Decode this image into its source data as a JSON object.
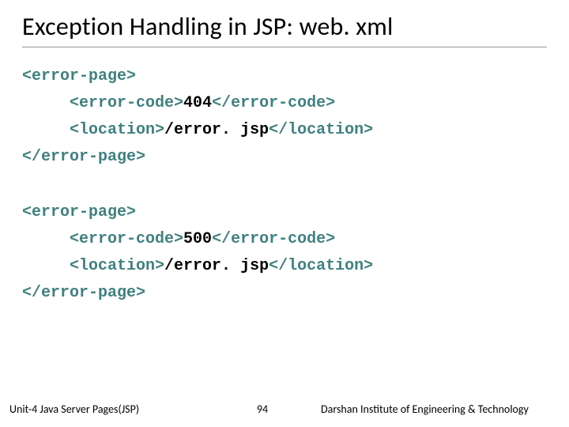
{
  "title": "Exception Handling in JSP: web. xml",
  "code_blocks": [
    {
      "open_outer": "<error-page>",
      "line1_open": "<error-code>",
      "line1_text": "404",
      "line1_close": "</error-code>",
      "line2_open": "<location>",
      "line2_text": "/error. jsp",
      "line2_close": "</location>",
      "close_outer": "</error-page>"
    },
    {
      "open_outer": "<error-page>",
      "line1_open": "<error-code>",
      "line1_text": "500",
      "line1_close": "</error-code>",
      "line2_open": "<location>",
      "line2_text": "/error. jsp",
      "line2_close": "</location>",
      "close_outer": "</error-page>"
    }
  ],
  "footer": {
    "left": "Unit-4 Java Server Pages(JSP)",
    "page": "94",
    "right": "Darshan Institute of Engineering & Technology"
  }
}
